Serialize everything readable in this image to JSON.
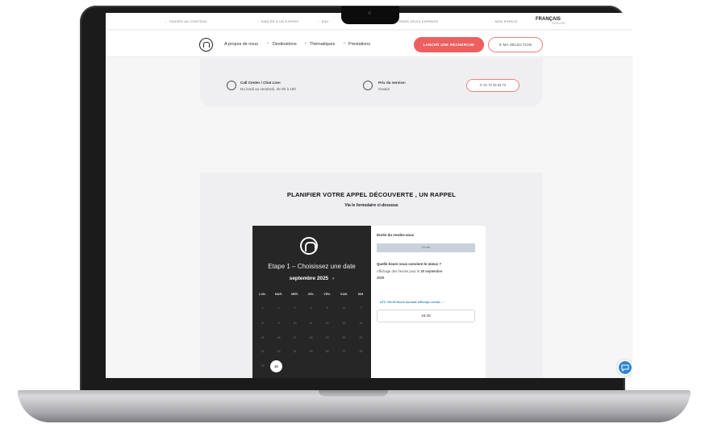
{
  "topbar": {
    "links": [
      "PASSER AU CONTENU",
      "PARLER À UN EXPERT",
      "ENV",
      "RDER DEVIS EXPRESS",
      "MON ESPACE"
    ],
    "lang_current": "FRANÇAIS",
    "lang_other": "ENGLISH"
  },
  "nav": {
    "items": [
      "A propos de nous",
      "Destinations",
      "Thématiques",
      "Prestations"
    ],
    "search_button": "LANCER UNE RECHERCHE",
    "selection_button": "MA SÉLECTION"
  },
  "contact": {
    "callcenter_title": "Call Center / Chat Live:",
    "callcenter_hours": "Du lundi au vendredi, de 9h à 18h",
    "price_title": "Prix du service:",
    "price_value": "Gratuit",
    "phone": "01 72 36 63 72"
  },
  "planner": {
    "title": "PLANIFIER VOTRE APPEL DÉCOUVERTE , UN RAPPEL",
    "subtitle": "Via le formulaire ci-dessous",
    "step": "Etape 1 – Choisissez une date",
    "month": "septembre 2025",
    "month_next": "›",
    "weekdays": [
      "LUN.",
      "MAR.",
      "MER.",
      "JEU.",
      "VEN.",
      "SAM.",
      "DIM."
    ],
    "days_row1": [
      "1",
      "2",
      "3",
      "4",
      "5",
      "6",
      "7"
    ],
    "days_row2": [
      "8",
      "9",
      "10",
      "11",
      "12",
      "13",
      "14"
    ],
    "days_row3": [
      "15",
      "16",
      "17",
      "18",
      "19",
      "20",
      "21"
    ],
    "days_row4": [
      "22",
      "23",
      "24",
      "25",
      "26",
      "27",
      "28"
    ],
    "days_row5": [
      "29"
    ],
    "selected_day": "30",
    "duration_label": "Durée du rendez-vous",
    "duration_value": "15 min",
    "time_question": "Quelle heure vous convient le mieux ?",
    "availability_prefix": "Affichage des heures pour le",
    "availability_date": "30 septembre",
    "availability_year": "2025",
    "timezone": "UTC +02:00 Heure normale d'Europe centra...",
    "timezone_chevron": "›",
    "slot": "16:45"
  },
  "colors": {
    "accent": "#ee5f5f",
    "calendar_bg": "#262626",
    "chat": "#2d86d2"
  }
}
